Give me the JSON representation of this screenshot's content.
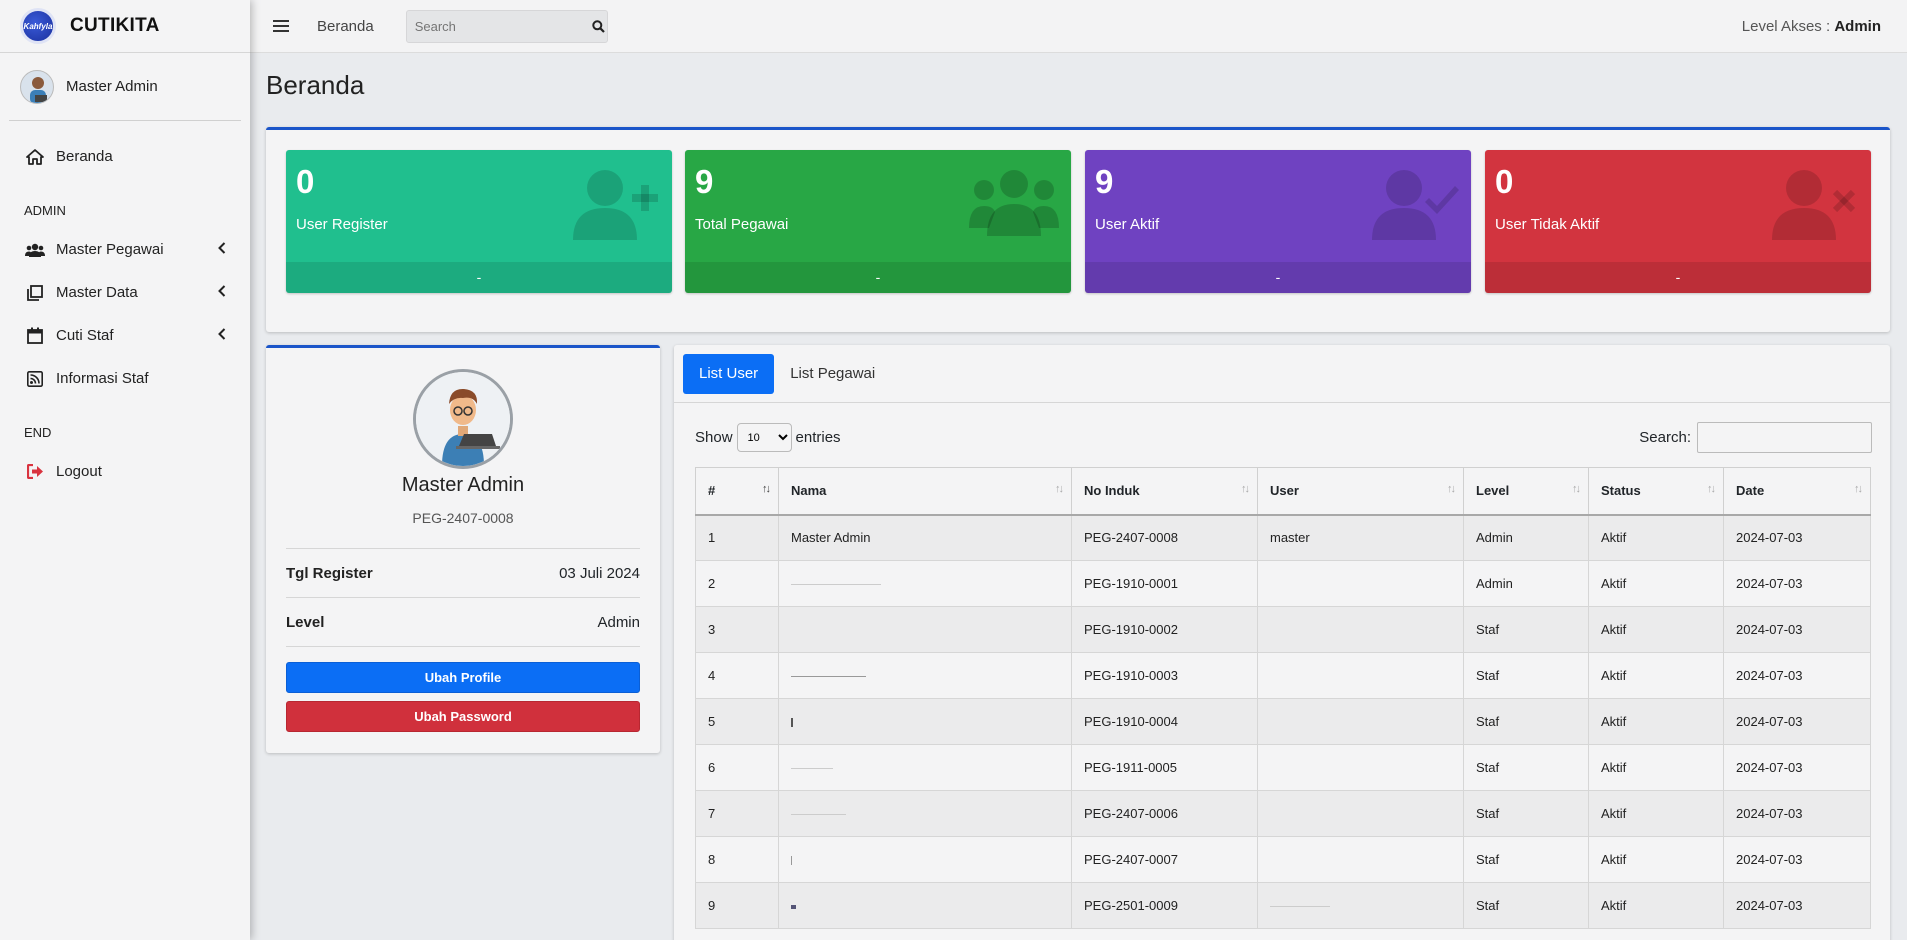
{
  "brand": {
    "logo_text": "Kahfyla",
    "name": "CUTIKITA"
  },
  "sidebar": {
    "user_name": "Master Admin",
    "items": [
      {
        "label": "Beranda",
        "icon": "home-icon"
      },
      {
        "header": "ADMIN"
      },
      {
        "label": "Master Pegawai",
        "icon": "users-icon"
      },
      {
        "label": "Master Data",
        "icon": "copy-icon"
      },
      {
        "label": "Cuti Staf",
        "icon": "calendar-icon"
      },
      {
        "label": "Informasi Staf",
        "icon": "rss-icon"
      },
      {
        "header": "END"
      },
      {
        "label": "Logout",
        "icon": "sign-out-icon"
      }
    ]
  },
  "topbar": {
    "link": "Beranda",
    "search_placeholder": "Search",
    "level_label": "Level Akses :",
    "level_value": "Admin"
  },
  "page_title": "Beranda",
  "stats": [
    {
      "value": "0",
      "label": "User Register",
      "footer": "-",
      "color": "#20bf8e",
      "icon": "user-plus-icon"
    },
    {
      "value": "9",
      "label": "Total Pegawai",
      "footer": "-",
      "color": "#28a745",
      "icon": "users-icon"
    },
    {
      "value": "9",
      "label": "User Aktif",
      "footer": "-",
      "color": "#6f42c1",
      "icon": "user-check-icon"
    },
    {
      "value": "0",
      "label": "User Tidak Aktif",
      "footer": "-",
      "color": "#dc3545",
      "icon": "user-times-icon"
    }
  ],
  "profile": {
    "name": "Master Admin",
    "id": "PEG-2407-0008",
    "register_label": "Tgl Register",
    "register_value": "03 Juli 2024",
    "level_label": "Level",
    "level_value": "Admin",
    "btn_profile": "Ubah Profile",
    "btn_password": "Ubah Password"
  },
  "tabs": {
    "active": "List User",
    "other": "List Pegawai"
  },
  "datatable": {
    "show_label": "Show",
    "entries_value": "10",
    "entries_label": "entries",
    "search_label": "Search:",
    "columns": [
      "#",
      "Nama",
      "No Induk",
      "User",
      "Level",
      "Status",
      "Date"
    ],
    "rows": [
      [
        "1",
        "Master Admin",
        "PEG-2407-0008",
        "master",
        "Admin",
        "Aktif",
        "2024-07-03"
      ],
      [
        "2",
        "",
        "PEG-1910-0001",
        "",
        "Admin",
        "Aktif",
        "2024-07-03"
      ],
      [
        "3",
        "",
        "PEG-1910-0002",
        "",
        "Staf",
        "Aktif",
        "2024-07-03"
      ],
      [
        "4",
        "",
        "PEG-1910-0003",
        "",
        "Staf",
        "Aktif",
        "2024-07-03"
      ],
      [
        "5",
        "",
        "PEG-1910-0004",
        "",
        "Staf",
        "Aktif",
        "2024-07-03"
      ],
      [
        "6",
        "",
        "PEG-1911-0005",
        "",
        "Staf",
        "Aktif",
        "2024-07-03"
      ],
      [
        "7",
        "",
        "PEG-2407-0006",
        "",
        "Staf",
        "Aktif",
        "2024-07-03"
      ],
      [
        "8",
        "",
        "PEG-2407-0007",
        "",
        "Staf",
        "Aktif",
        "2024-07-03"
      ],
      [
        "9",
        "",
        "PEG-2501-0009",
        "",
        "Staf",
        "Aktif",
        "2024-07-03"
      ]
    ]
  }
}
